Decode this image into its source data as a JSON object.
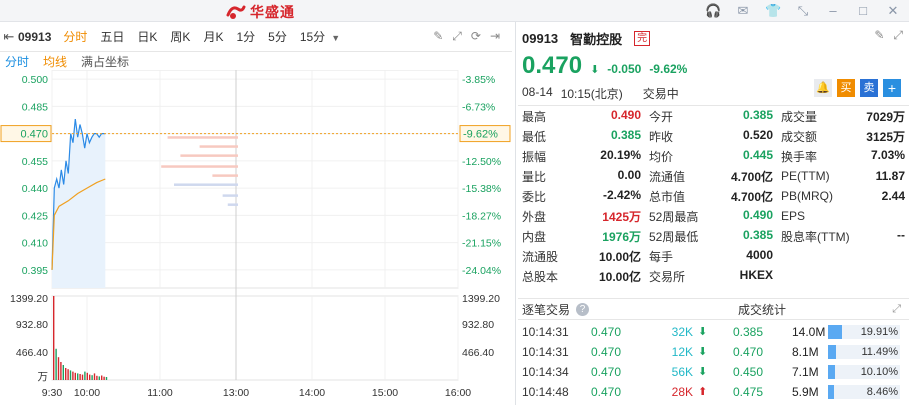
{
  "header": {
    "logo_text": "华盛通"
  },
  "chart_toolbar": {
    "code": "09913",
    "tabs": [
      {
        "label": "分时",
        "active": true
      },
      {
        "label": "五日"
      },
      {
        "label": "日K"
      },
      {
        "label": "周K"
      },
      {
        "label": "月K"
      },
      {
        "label": "1分"
      },
      {
        "label": "5分"
      },
      {
        "label": "15分"
      }
    ]
  },
  "chart_sub": {
    "fenshi": "分时",
    "junxian": "均线",
    "manzhan": "满占坐标"
  },
  "chart_data": {
    "type": "line",
    "price_axis": {
      "left_labels": [
        "0.500",
        "0.485",
        "0.470",
        "0.455",
        "0.440",
        "0.425",
        "0.410",
        "0.395"
      ],
      "right_labels": [
        "-3.85%",
        "-6.73%",
        "-9.62%",
        "-12.50%",
        "-15.38%",
        "-18.27%",
        "-21.15%",
        "-24.04%"
      ],
      "ylim": [
        0.385,
        0.505
      ]
    },
    "current_label": {
      "price": "0.470",
      "pct": "-9.62%"
    },
    "x_ticks": [
      "9:30",
      "10:00",
      "11:00",
      "13:00",
      "14:00",
      "15:00",
      "16:00"
    ],
    "volume_axis": {
      "left": [
        "1399.20",
        "932.80",
        "466.40",
        "万"
      ],
      "right": [
        "1399.20",
        "932.80",
        "466.40"
      ]
    },
    "price_series": [
      {
        "t": "9:30",
        "p": 0.395
      },
      {
        "t": "9:32",
        "p": 0.44
      },
      {
        "t": "9:34",
        "p": 0.445
      },
      {
        "t": "9:36",
        "p": 0.44
      },
      {
        "t": "9:38",
        "p": 0.45
      },
      {
        "t": "9:40",
        "p": 0.442
      },
      {
        "t": "9:42",
        "p": 0.455
      },
      {
        "t": "9:44",
        "p": 0.448
      },
      {
        "t": "9:46",
        "p": 0.47
      },
      {
        "t": "9:48",
        "p": 0.465
      },
      {
        "t": "9:50",
        "p": 0.478
      },
      {
        "t": "9:52",
        "p": 0.468
      },
      {
        "t": "9:54",
        "p": 0.475
      },
      {
        "t": "9:56",
        "p": 0.47
      },
      {
        "t": "9:58",
        "p": 0.462
      },
      {
        "t": "10:00",
        "p": 0.47
      },
      {
        "t": "10:02",
        "p": 0.465
      },
      {
        "t": "10:04",
        "p": 0.468
      },
      {
        "t": "10:06",
        "p": 0.47
      },
      {
        "t": "10:08",
        "p": 0.47
      },
      {
        "t": "10:10",
        "p": 0.468
      },
      {
        "t": "10:12",
        "p": 0.47
      },
      {
        "t": "10:15",
        "p": 0.47
      }
    ],
    "avg_series": [
      {
        "t": "9:30",
        "p": 0.395
      },
      {
        "t": "9:32",
        "p": 0.425
      },
      {
        "t": "9:36",
        "p": 0.43
      },
      {
        "t": "9:44",
        "p": 0.433
      },
      {
        "t": "9:52",
        "p": 0.437
      },
      {
        "t": "10:00",
        "p": 0.44
      },
      {
        "t": "10:08",
        "p": 0.443
      },
      {
        "t": "10:15",
        "p": 0.445
      }
    ],
    "depth_bars": [
      {
        "p": 0.468,
        "len": 0.55
      },
      {
        "p": 0.463,
        "len": 0.3
      },
      {
        "p": 0.458,
        "len": 0.45
      },
      {
        "p": 0.452,
        "len": 0.6
      },
      {
        "p": 0.447,
        "len": 0.2
      },
      {
        "p": 0.442,
        "len": 0.5
      },
      {
        "p": 0.436,
        "len": 0.12
      },
      {
        "p": 0.431,
        "len": 0.08
      }
    ],
    "volume_series": [
      1399.2,
      520,
      380,
      300,
      250,
      200,
      180,
      160,
      140,
      120,
      110,
      100,
      90,
      140,
      120,
      90,
      80,
      110,
      70,
      60,
      75,
      55,
      50
    ]
  },
  "quote": {
    "code": "09913",
    "name": "智勤控股",
    "badge": "完",
    "price": "0.470",
    "change": "-0.050",
    "change_pct": "-9.62%",
    "date": "08-14",
    "time": "10:15(北京)",
    "status": "交易中",
    "buy_label": "买",
    "sell_label": "卖",
    "plus_label": "+"
  },
  "stats": [
    [
      {
        "l": "最高",
        "v": "0.490",
        "c": "red"
      },
      {
        "l": "今开",
        "v": "0.385",
        "c": "grn"
      },
      {
        "l": "成交量",
        "v": "7029万",
        "c": ""
      }
    ],
    [
      {
        "l": "最低",
        "v": "0.385",
        "c": "grn"
      },
      {
        "l": "昨收",
        "v": "0.520",
        "c": ""
      },
      {
        "l": "成交额",
        "v": "3125万",
        "c": ""
      }
    ],
    [
      {
        "l": "振幅",
        "v": "20.19%",
        "c": ""
      },
      {
        "l": "均价",
        "v": "0.445",
        "c": "grn"
      },
      {
        "l": "换手率",
        "v": "7.03%",
        "c": ""
      }
    ],
    [
      {
        "l": "量比",
        "v": "0.00",
        "c": ""
      },
      {
        "l": "流通值",
        "v": "4.700亿",
        "c": ""
      },
      {
        "l": "PE(TTM)",
        "v": "11.87",
        "c": ""
      }
    ],
    [
      {
        "l": "委比",
        "v": "-2.42%",
        "c": ""
      },
      {
        "l": "总市值",
        "v": "4.700亿",
        "c": ""
      },
      {
        "l": "PB(MRQ)",
        "v": "2.44",
        "c": ""
      }
    ],
    [
      {
        "l": "外盘",
        "v": "1425万",
        "c": "red"
      },
      {
        "l": "52周最高",
        "v": "0.490",
        "c": "grn"
      },
      {
        "l": "EPS",
        "v": "",
        "c": ""
      }
    ],
    [
      {
        "l": "内盘",
        "v": "1976万",
        "c": "grn"
      },
      {
        "l": "52周最低",
        "v": "0.385",
        "c": "grn"
      },
      {
        "l": "股息率(TTM)",
        "v": "--",
        "c": ""
      }
    ],
    [
      {
        "l": "流通股",
        "v": "10.00亿",
        "c": ""
      },
      {
        "l": "每手",
        "v": "4000",
        "c": ""
      },
      {
        "l": "",
        "v": "",
        "c": ""
      }
    ],
    [
      {
        "l": "总股本",
        "v": "10.00亿",
        "c": ""
      },
      {
        "l": "交易所",
        "v": "HKEX",
        "c": ""
      },
      {
        "l": "",
        "v": "",
        "c": ""
      }
    ]
  ],
  "trades_header": {
    "left": "逐笔交易",
    "right": "成交统计"
  },
  "trades": [
    {
      "time": "10:14:31",
      "price": "0.470",
      "vol": "32K",
      "dir": "down",
      "sp": "0.385",
      "sv": "14.0M",
      "pct": "19.91%",
      "frac": 0.1991
    },
    {
      "time": "10:14:31",
      "price": "0.470",
      "vol": "12K",
      "dir": "down",
      "sp": "0.470",
      "sv": "8.1M",
      "pct": "11.49%",
      "frac": 0.1149
    },
    {
      "time": "10:14:34",
      "price": "0.470",
      "vol": "56K",
      "dir": "down",
      "sp": "0.450",
      "sv": "7.1M",
      "pct": "10.10%",
      "frac": 0.101
    },
    {
      "time": "10:14:48",
      "price": "0.470",
      "vol": "28K",
      "dir": "up",
      "sp": "0.475",
      "sv": "5.9M",
      "pct": "8.46%",
      "frac": 0.0846
    }
  ]
}
